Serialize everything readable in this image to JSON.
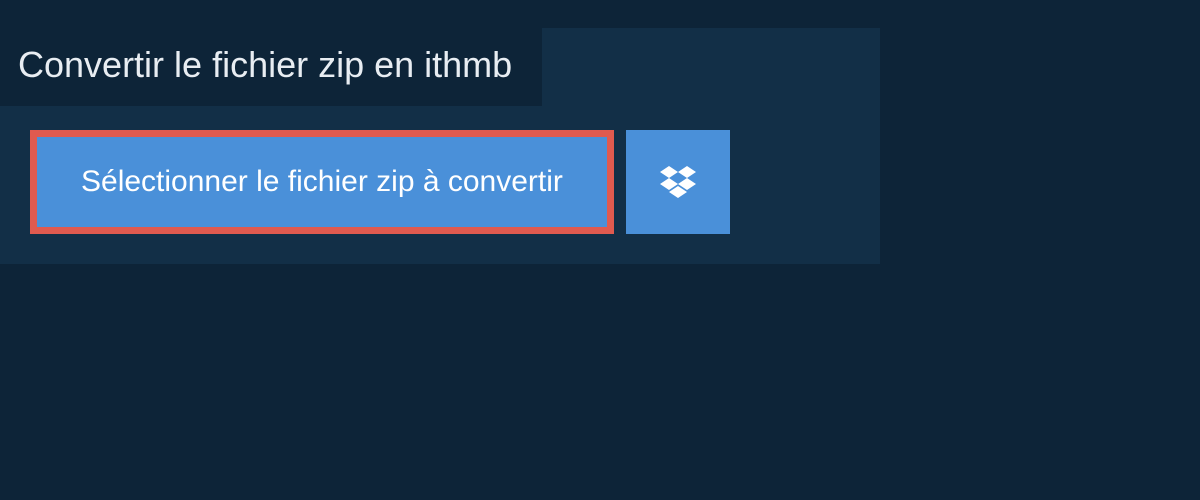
{
  "title": "Convertir le fichier zip en ithmb",
  "selectButton": {
    "label": "Sélectionner le fichier zip à convertir"
  },
  "dropboxButton": {
    "iconName": "dropbox-icon"
  }
}
